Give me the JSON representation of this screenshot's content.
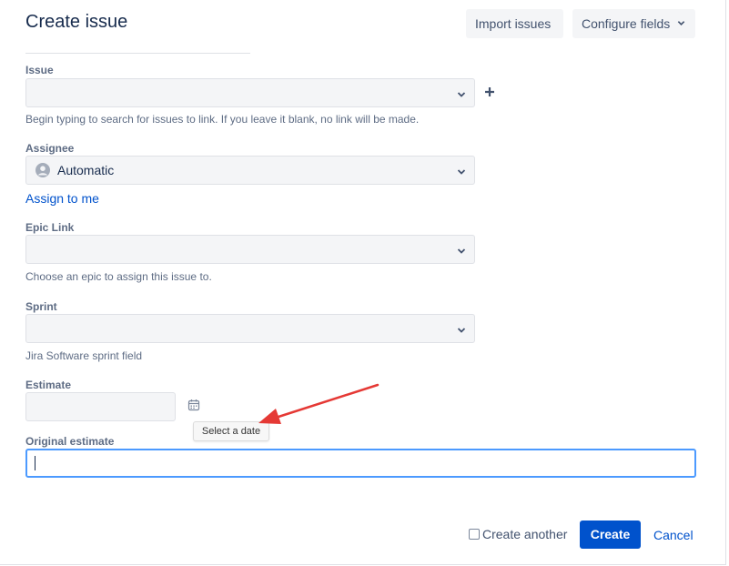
{
  "dialog": {
    "title": "Create issue",
    "import_label": "Import issues",
    "configure_label": "Configure fields"
  },
  "fields": {
    "issue": {
      "label": "Issue",
      "value": "",
      "description": "Begin typing to search for issues to link. If you leave it blank, no link will be made."
    },
    "assignee": {
      "label": "Assignee",
      "value": "Automatic",
      "assign_link": "Assign to me"
    },
    "epic_link": {
      "label": "Epic Link",
      "value": "",
      "description": "Choose an epic to assign this issue to."
    },
    "sprint": {
      "label": "Sprint",
      "value": "",
      "description": "Jira Software sprint field"
    },
    "estimate": {
      "label": "Estimate",
      "value": "",
      "tooltip": "Select a date"
    },
    "original_estimate": {
      "label": "Original estimate",
      "value": ""
    }
  },
  "footer": {
    "create_another_label": "Create another",
    "create_another_checked": false,
    "create_label": "Create",
    "cancel_label": "Cancel"
  },
  "colors": {
    "primary": "#0052cc",
    "focus_border": "#4c9aff",
    "annotation_arrow": "#e53935"
  },
  "icons": [
    "chevron-down-icon",
    "plus-icon",
    "avatar-icon",
    "calendar-icon",
    "annotation-arrow"
  ]
}
